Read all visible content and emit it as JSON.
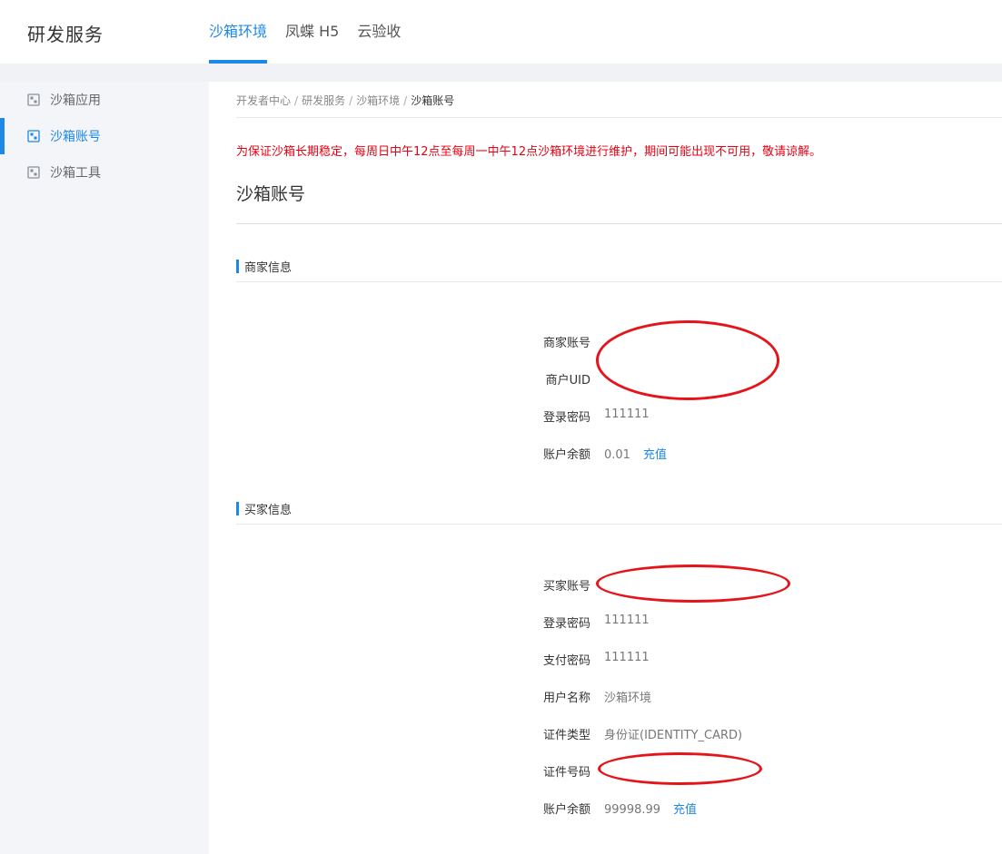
{
  "header": {
    "brand": "研发服务",
    "tabs": [
      {
        "label": "沙箱环境",
        "active": true
      },
      {
        "label": "凤蝶 H5",
        "active": false
      },
      {
        "label": "云验收",
        "active": false
      }
    ]
  },
  "sidebar": {
    "items": [
      {
        "label": "沙箱应用",
        "icon": "app-grid-icon",
        "active": false
      },
      {
        "label": "沙箱账号",
        "icon": "app-grid-icon",
        "active": true
      },
      {
        "label": "沙箱工具",
        "icon": "app-grid-icon",
        "active": false
      }
    ]
  },
  "breadcrumb": [
    "开发者中心",
    "研发服务",
    "沙箱环境",
    "沙箱账号"
  ],
  "breadcrumb_sep": "/",
  "notice": "为保证沙箱长期稳定，每周日中午12点至每周一中午12点沙箱环境进行维护，期间可能出现不可用，敬请谅解。",
  "page_title": "沙箱账号",
  "merchant": {
    "section_title": "商家信息",
    "account_label": "商家账号",
    "account_value": "",
    "uid_label": "商户UID",
    "uid_value": "",
    "password_label": "登录密码",
    "password_value": "111111",
    "balance_label": "账户余额",
    "balance_value": "0.01",
    "recharge_label": "充值"
  },
  "buyer": {
    "section_title": "买家信息",
    "account_label": "买家账号",
    "account_value": "",
    "login_password_label": "登录密码",
    "login_password_value": "111111",
    "pay_password_label": "支付密码",
    "pay_password_value": "111111",
    "username_label": "用户名称",
    "username_value": "沙箱环境",
    "id_type_label": "证件类型",
    "id_type_value": "身份证(IDENTITY_CARD)",
    "id_number_label": "证件号码",
    "id_number_value": "",
    "balance_label": "账户余额",
    "balance_value": "99998.99",
    "recharge_label": "充值"
  },
  "colors": {
    "accent": "#1e88e5",
    "notice": "#e60012",
    "redaction": "#e5141b",
    "sidebar_bg": "#f3f5f8"
  }
}
